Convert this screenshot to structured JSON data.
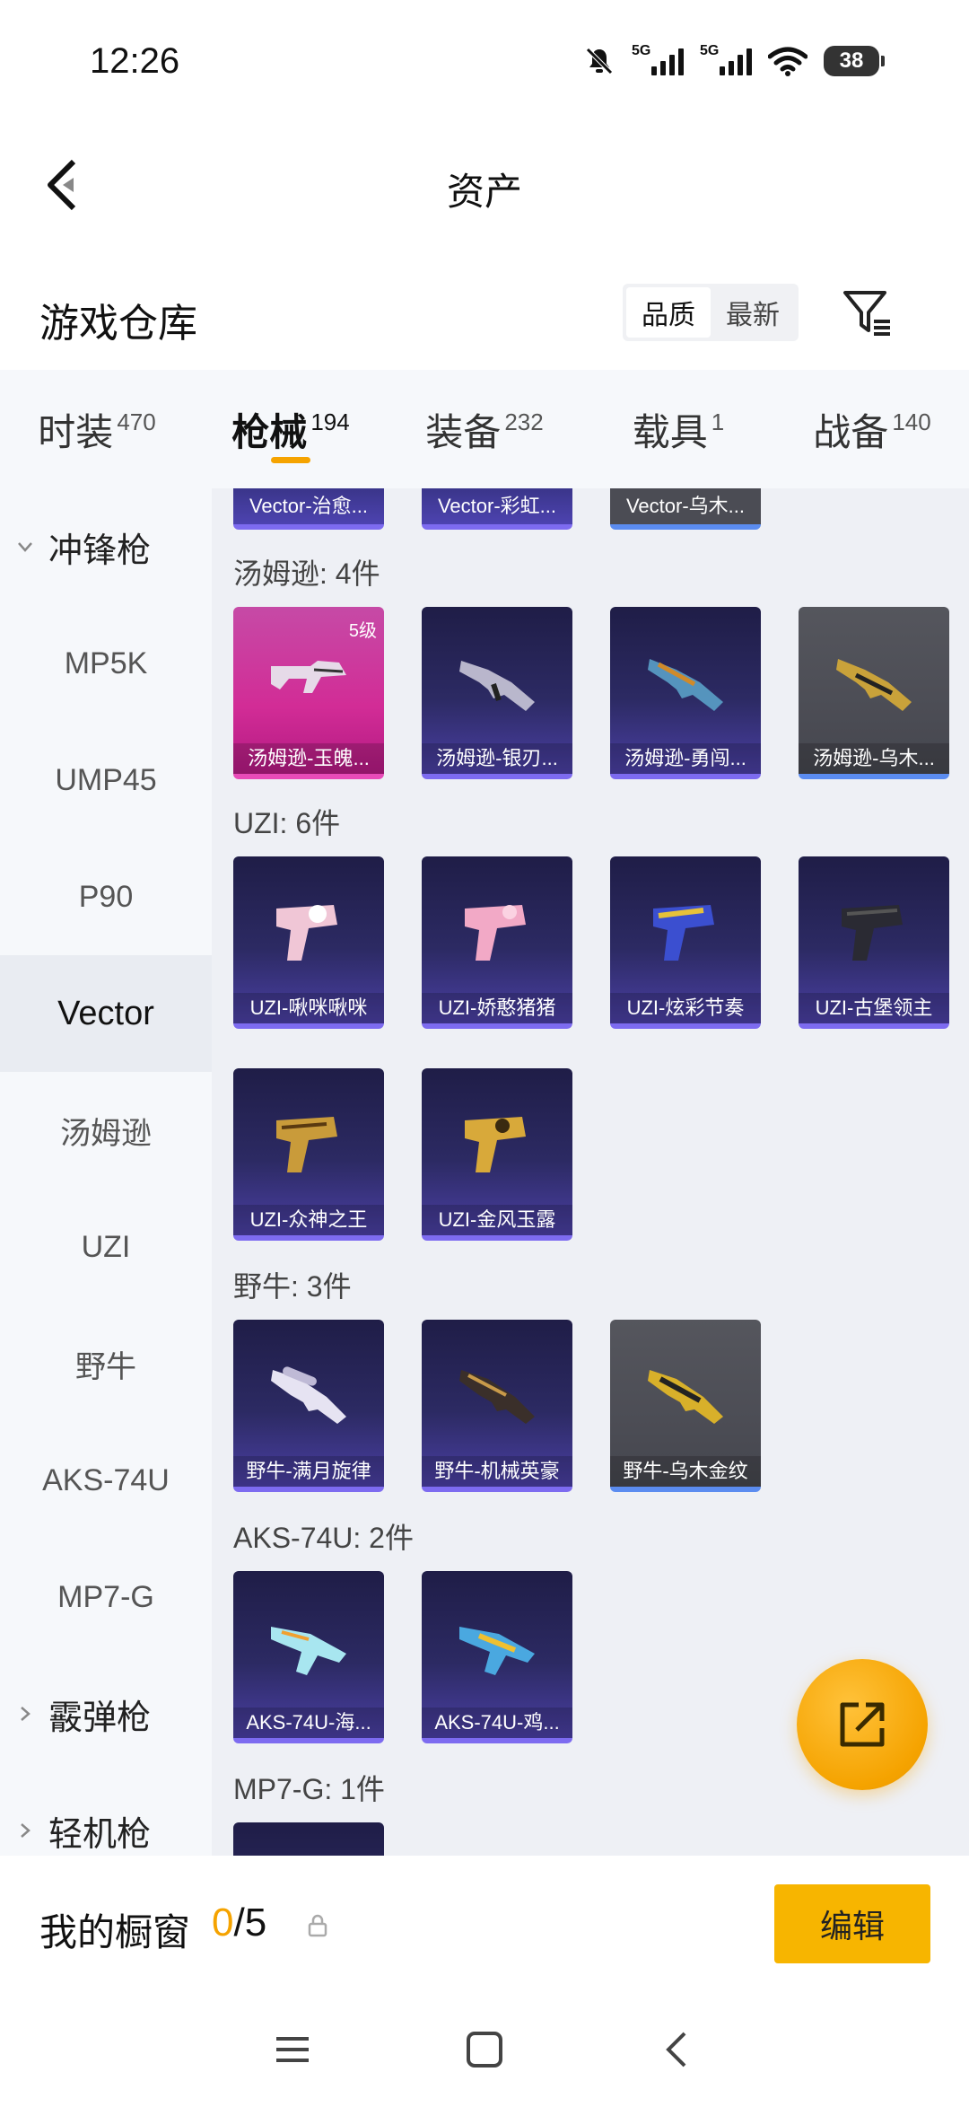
{
  "status_bar": {
    "time": "12:26",
    "network_1": "5G",
    "network_2": "5G",
    "battery": "38"
  },
  "header": {
    "title": "资产"
  },
  "warehouse": {
    "title": "游戏仓库",
    "sort_options": [
      "品质",
      "最新"
    ],
    "active_sort": "品质"
  },
  "tabs": [
    {
      "label": "时装",
      "count": "470"
    },
    {
      "label": "枪械",
      "count": "194",
      "active": true
    },
    {
      "label": "装备",
      "count": "232"
    },
    {
      "label": "载具",
      "count": "1"
    },
    {
      "label": "战备",
      "count": "140"
    }
  ],
  "sidebar": {
    "group_smg": "冲锋枪",
    "items": [
      "MP5K",
      "UMP45",
      "P90",
      "Vector",
      "汤姆逊",
      "UZI",
      "野牛",
      "AKS-74U",
      "MP7-G"
    ],
    "active_item": "Vector",
    "group_shotgun": "霰弹枪",
    "group_lmg": "轻机枪"
  },
  "content": {
    "top_strip": [
      "Vector-治愈...",
      "Vector-彩虹...",
      "Vector-乌木..."
    ],
    "groups": [
      {
        "title": "汤姆逊: 4件",
        "items": [
          {
            "name": "汤姆逊-玉魄...",
            "quality": "pink",
            "level": "5级"
          },
          {
            "name": "汤姆逊-银刃...",
            "quality": "purple"
          },
          {
            "name": "汤姆逊-勇闯...",
            "quality": "purple"
          },
          {
            "name": "汤姆逊-乌木...",
            "quality": "gray"
          }
        ]
      },
      {
        "title": "UZI: 6件",
        "items": [
          {
            "name": "UZI-啾咪啾咪",
            "quality": "purple"
          },
          {
            "name": "UZI-娇憨猪猪",
            "quality": "purple"
          },
          {
            "name": "UZI-炫彩节奏",
            "quality": "purple"
          },
          {
            "name": "UZI-古堡领主",
            "quality": "purple"
          },
          {
            "name": "UZI-众神之王",
            "quality": "purple"
          },
          {
            "name": "UZI-金风玉露",
            "quality": "purple"
          }
        ]
      },
      {
        "title": "野牛: 3件",
        "items": [
          {
            "name": "野牛-满月旋律",
            "quality": "purple"
          },
          {
            "name": "野牛-机械英豪",
            "quality": "purple"
          },
          {
            "name": "野牛-乌木金纹",
            "quality": "gray"
          }
        ]
      },
      {
        "title": "AKS-74U: 2件",
        "items": [
          {
            "name": "AKS-74U-海...",
            "quality": "purple"
          },
          {
            "name": "AKS-74U-鸡...",
            "quality": "purple"
          }
        ]
      },
      {
        "title": "MP7-G: 1件",
        "items": []
      }
    ]
  },
  "showcase": {
    "title": "我的橱窗",
    "current": "0",
    "total": "/5",
    "edit_label": "编辑"
  },
  "colors": {
    "accent": "#f5a300",
    "purple_quality": "#7d6bf0",
    "pink_quality": "#e84bb8",
    "gray_quality": "#5b8cf0"
  }
}
